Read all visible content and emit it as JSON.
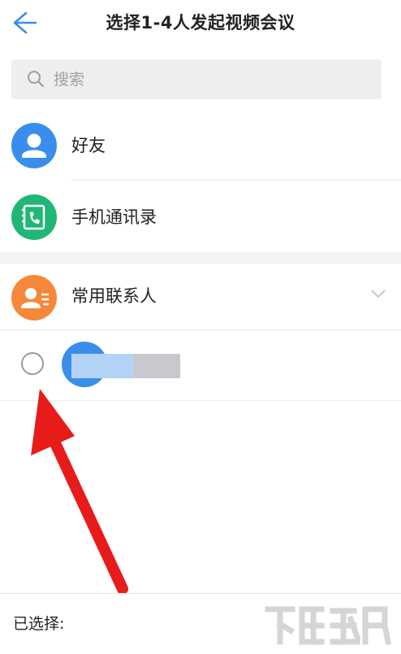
{
  "header": {
    "title": "选择1-4人发起视频会议",
    "back_icon": "arrow-left-icon"
  },
  "search": {
    "placeholder": "搜索",
    "value": "",
    "icon": "search-icon"
  },
  "menu": [
    {
      "label": "好友",
      "icon": "person-icon",
      "color": "#3a8eeb"
    },
    {
      "label": "手机通讯录",
      "icon": "phone-book-icon",
      "color": "#20b776"
    }
  ],
  "frequent": {
    "label": "常用联系人",
    "icon": "contact-card-icon",
    "color": "#f6883a",
    "expand_icon": "chevron-down-icon"
  },
  "contacts": [
    {
      "name": "",
      "avatar_color": "#3a8eeb",
      "selected": false
    }
  ],
  "footer": {
    "selected_label": "已选择:"
  },
  "colors": {
    "accent": "#3a8eeb",
    "arrow": "#e81b1b"
  }
}
